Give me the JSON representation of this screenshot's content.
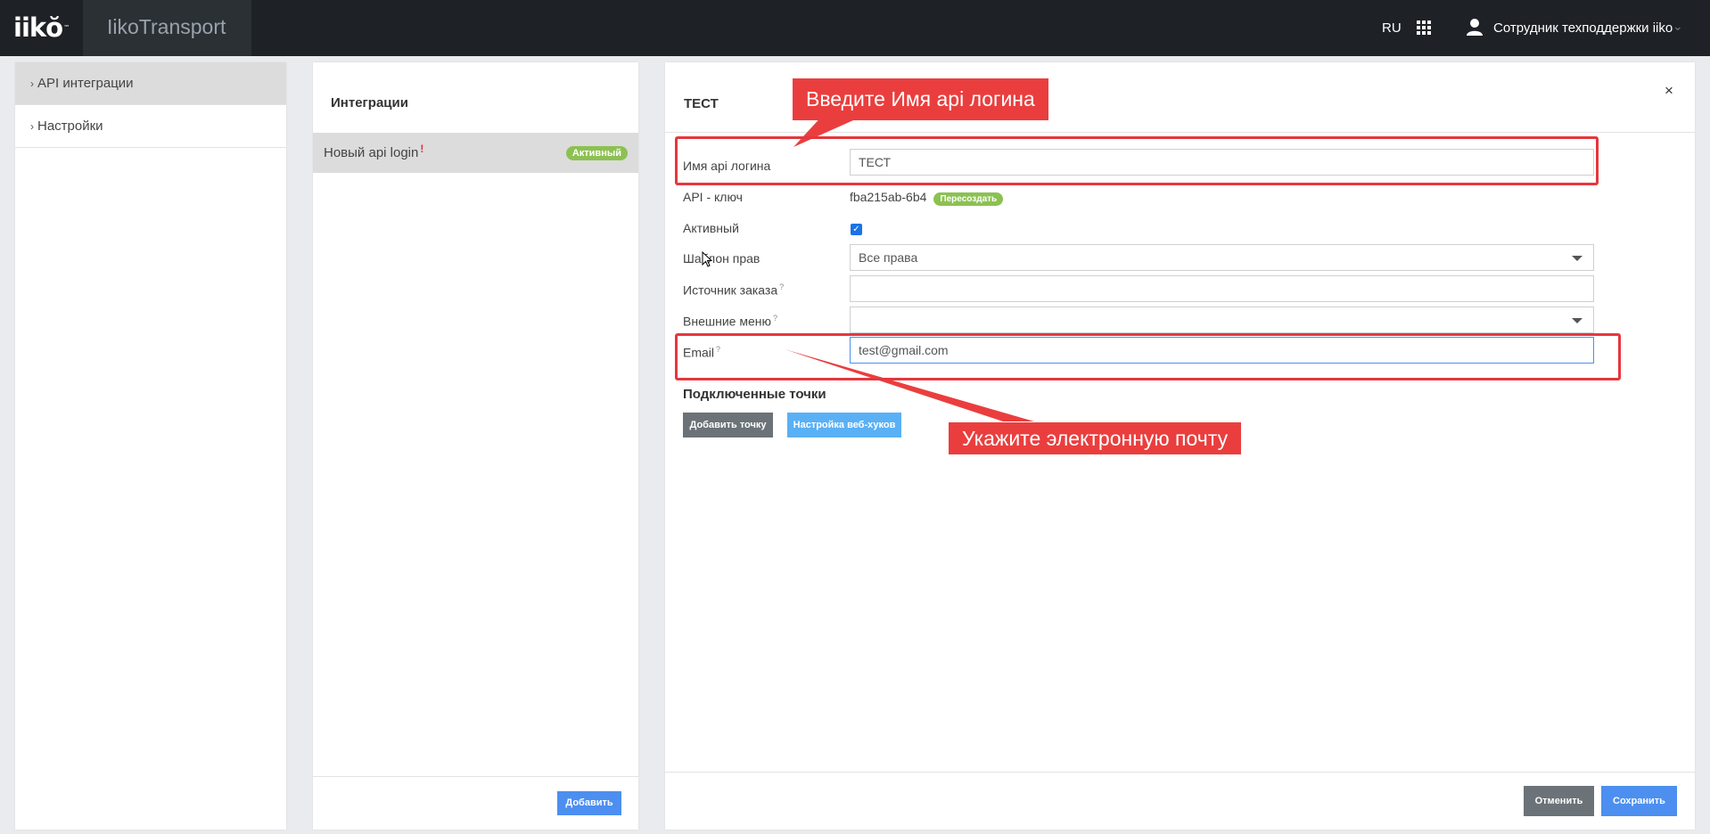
{
  "header": {
    "logo_text": "iikŏ",
    "logo_tm": "™",
    "app_name": "IikoTransport",
    "language": "RU",
    "user_name": "Сотрудник техподдержки iiko"
  },
  "sidebar": {
    "items": [
      {
        "label": "API интеграции"
      },
      {
        "label": "Настройки"
      }
    ]
  },
  "integrations": {
    "title": "Интеграции",
    "items": [
      {
        "name": "Новый api login",
        "warning": "!",
        "status": "Активный"
      }
    ],
    "add_label": "Добавить"
  },
  "detail": {
    "title": "ТЕСТ",
    "close": "×",
    "fields": {
      "login_name": {
        "label": "Имя api логина",
        "value": "ТЕСТ"
      },
      "api_key": {
        "label": "API - ключ",
        "value": "fba215ab-6b4",
        "regenerate": "Пересоздать"
      },
      "active": {
        "label": "Активный",
        "checked": true
      },
      "rights_template": {
        "label": "Шаблон прав",
        "value": "Все права"
      },
      "order_source": {
        "label": "Источник заказа",
        "hint": "?",
        "value": ""
      },
      "external_menu": {
        "label": "Внешние меню",
        "hint": "?",
        "value": ""
      },
      "email": {
        "label": "Email",
        "hint": "?",
        "value": "test@gmail.com"
      }
    },
    "points_title": "Подключенные точки",
    "add_point_label": "Добавить точку",
    "webhooks_label": "Настройка веб-хуков",
    "cancel_label": "Отменить",
    "save_label": "Сохранить"
  },
  "annotations": {
    "callout_login": "Введите Имя api логина",
    "callout_email": "Укажите электронную почту",
    "color": "#ea3e3e"
  }
}
